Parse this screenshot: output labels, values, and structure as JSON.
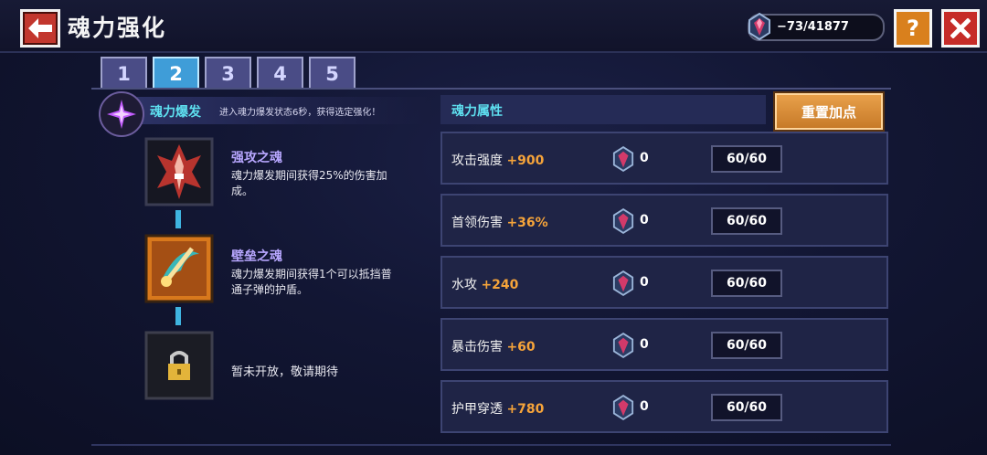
{
  "header": {
    "title": "魂力强化",
    "currency": "−73/41877"
  },
  "tabs": [
    "1",
    "2",
    "3",
    "4",
    "5"
  ],
  "active_tab": 1,
  "burst": {
    "title": "魂力爆发",
    "description": "进入魂力爆发状态6秒，获得选定强化！"
  },
  "skills": [
    {
      "name": "强攻之魂",
      "desc_lines": [
        "魂力爆发期间获得25%的伤害加",
        "成。"
      ]
    },
    {
      "name": "壁垒之魂",
      "desc_lines": [
        "魂力爆发期间获得1个可以抵挡普",
        "通子弹的护盾。"
      ]
    }
  ],
  "locked": {
    "text": "暂未开放，敬请期待"
  },
  "attributes": {
    "title": "魂力属性",
    "reset_label": "重置加点",
    "rows": [
      {
        "label": "攻击强度",
        "bonus": "+900",
        "count": "0",
        "level": "60/60"
      },
      {
        "label": "首领伤害",
        "bonus": "+36%",
        "count": "0",
        "level": "60/60"
      },
      {
        "label": "水攻",
        "bonus": "+240",
        "count": "0",
        "level": "60/60"
      },
      {
        "label": "暴击伤害",
        "bonus": "+60",
        "count": "0",
        "level": "60/60"
      },
      {
        "label": "护甲穿透",
        "bonus": "+780",
        "count": "0",
        "level": "60/60"
      }
    ]
  },
  "colors": {
    "accent_cyan": "#5ee0f0",
    "bonus_orange": "#f6a43a",
    "skill_purple": "#b8a7ff"
  },
  "icons": {
    "back": "arrow-left-icon",
    "help": "question-icon",
    "close": "close-icon",
    "currency": "soul-gem-icon",
    "burst": "burst-star-icon",
    "skill_1": "attack-soul-icon",
    "skill_2": "shield-soul-icon",
    "locked": "lock-icon"
  }
}
